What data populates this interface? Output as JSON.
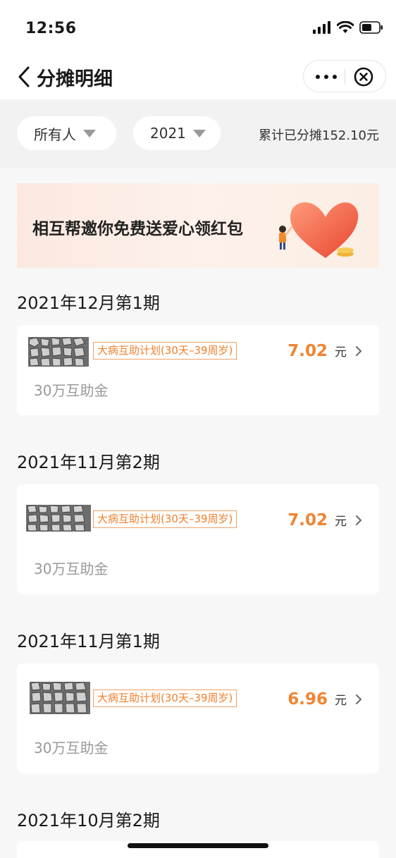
{
  "status_bar": {
    "time": "12:56"
  },
  "nav": {
    "title": "分摊明细"
  },
  "filters": {
    "person": "所有人",
    "year": "2021",
    "total": "累计已分摊152.10元"
  },
  "banner": {
    "text": "相互帮邀你免费送爱心领红包"
  },
  "periods": [
    {
      "title": "2021年12月第1期",
      "plan": "大病互助计划(30天–39周岁)",
      "amount": "7.02",
      "unit": "元",
      "benefit": "30万互助金"
    },
    {
      "title": "2021年11月第2期",
      "plan": "大病互助计划(30天–39周岁)",
      "amount": "7.02",
      "unit": "元",
      "benefit": "30万互助金"
    },
    {
      "title": "2021年11月第1期",
      "plan": "大病互助计划(30天–39周岁)",
      "amount": "6.96",
      "unit": "元",
      "benefit": "30万互助金"
    },
    {
      "title": "2021年10月第2期"
    }
  ],
  "colors": {
    "accent": "#f08432",
    "tag_border": "#f0a167"
  },
  "icons": [
    "back-arrow-icon",
    "more-dots-icon",
    "close-circle-icon",
    "signal-icon",
    "wifi-icon",
    "battery-icon",
    "dropdown-triangle-icon",
    "chevron-right-icon"
  ]
}
